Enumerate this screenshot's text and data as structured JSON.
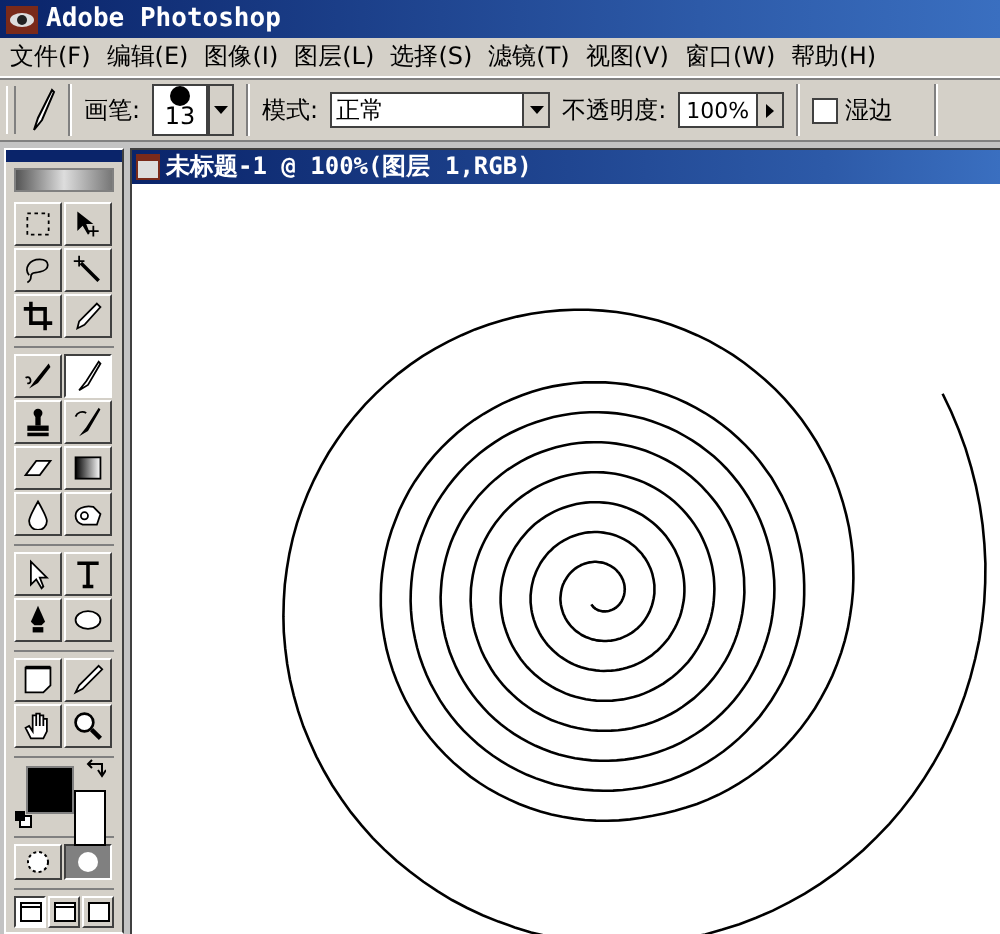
{
  "window": {
    "title": "Adobe Photoshop"
  },
  "menu": [
    {
      "label": "文件(F)"
    },
    {
      "label": "编辑(E)"
    },
    {
      "label": "图像(I)"
    },
    {
      "label": "图层(L)"
    },
    {
      "label": "选择(S)"
    },
    {
      "label": "滤镜(T)"
    },
    {
      "label": "视图(V)"
    },
    {
      "label": "窗口(W)"
    },
    {
      "label": "帮助(H)"
    }
  ],
  "options_bar": {
    "brush_label": "画笔:",
    "brush_size": "13",
    "mode_label": "模式:",
    "mode_value": "正常",
    "opacity_label": "不透明度:",
    "opacity_value": "100%",
    "wet_edges": {
      "label": "湿边",
      "checked": false
    }
  },
  "toolbox": {
    "tools": [
      {
        "selected": false
      },
      {
        "selected": false
      },
      {
        "selected": false
      },
      {
        "selected": false
      },
      {
        "selected": false
      },
      {
        "selected": false
      },
      {
        "selected": false
      },
      {
        "selected": true
      },
      {
        "selected": false
      },
      {
        "selected": false
      },
      {
        "selected": false
      },
      {
        "selected": false
      },
      {
        "selected": false
      },
      {
        "selected": false
      },
      {
        "selected": false
      },
      {
        "selected": false
      },
      {
        "selected": false
      },
      {
        "selected": false
      },
      {
        "selected": false
      },
      {
        "selected": false
      },
      {
        "selected": false
      },
      {
        "selected": false
      }
    ],
    "mask_modes": [
      {
        "selected": false
      },
      {
        "selected": true
      }
    ],
    "screen_modes": [
      {
        "selected": true
      },
      {
        "selected": false
      },
      {
        "selected": false
      }
    ]
  },
  "document": {
    "title": "未标题-1 @ 100%(图层 1,RGB)"
  }
}
